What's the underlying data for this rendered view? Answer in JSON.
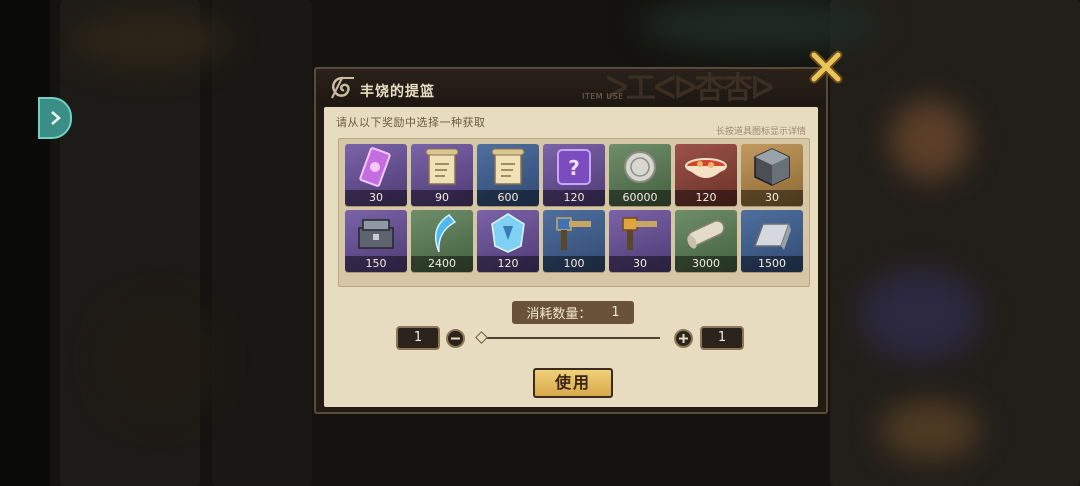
{
  "dialog": {
    "title": "丰饶的提篮",
    "tag": "ITEM USE",
    "header_deco": "ᐳ工ᐸᐅ杏杏ᐅ",
    "instruction": "请从以下奖励中选择一种获取",
    "hint": "长按道具图标显示详情"
  },
  "items": [
    {
      "icon": "purple-ticket-icon",
      "count": "30",
      "rarity": "purple"
    },
    {
      "icon": "scroll-icon",
      "count": "90",
      "rarity": "purple"
    },
    {
      "icon": "scroll-icon",
      "count": "600",
      "rarity": "blue"
    },
    {
      "icon": "mystery-box-icon",
      "count": "120",
      "rarity": "purple"
    },
    {
      "icon": "silver-coin-icon",
      "count": "60000",
      "rarity": "green"
    },
    {
      "icon": "ramen-bowl-icon",
      "count": "120",
      "rarity": "red"
    },
    {
      "icon": "ore-cube-icon",
      "count": "30",
      "rarity": "orange"
    },
    {
      "icon": "iron-chest-icon",
      "count": "150",
      "rarity": "purple"
    },
    {
      "icon": "crystal-shard-icon",
      "count": "2400",
      "rarity": "green"
    },
    {
      "icon": "crystal-rune-icon",
      "count": "120",
      "rarity": "purple"
    },
    {
      "icon": "blue-hammer-icon",
      "count": "100",
      "rarity": "blue"
    },
    {
      "icon": "gold-hammer-icon",
      "count": "30",
      "rarity": "purple"
    },
    {
      "icon": "paper-roll-icon",
      "count": "3000",
      "rarity": "green"
    },
    {
      "icon": "silver-ingot-icon",
      "count": "1500",
      "rarity": "blue"
    }
  ],
  "quantity": {
    "label": "消耗数量：",
    "value": "1",
    "min_value": "1",
    "max_value": "1",
    "slider_level": 0
  },
  "use_button": "使用",
  "colors": {
    "accent_gold": "#d7a94a",
    "panel_beige": "#e8dcc0",
    "frame_dark": "#221b14",
    "close_gold": "#e8c45a"
  }
}
